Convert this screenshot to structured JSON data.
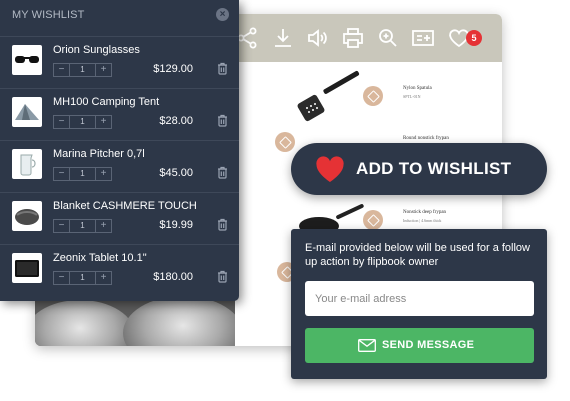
{
  "wishlist": {
    "title": "MY WISHLIST",
    "close_icon": "close-icon",
    "items": [
      {
        "name": "Orion Sunglasses",
        "qty": "1",
        "price": "$129.00",
        "minus": "−",
        "plus": "+"
      },
      {
        "name": "MH100 Camping Tent",
        "qty": "1",
        "price": "$28.00",
        "minus": "−",
        "plus": "+"
      },
      {
        "name": "Marina Pitcher 0,7l",
        "qty": "1",
        "price": "$45.00",
        "minus": "−",
        "plus": "+"
      },
      {
        "name": "Blanket CASHMERE TOUCH",
        "qty": "1",
        "price": "$19.99",
        "minus": "−",
        "plus": "+"
      },
      {
        "name": "Zeonix Tablet 10.1\"",
        "qty": "1",
        "price": "$180.00",
        "minus": "−",
        "plus": "+"
      }
    ]
  },
  "toolbar": {
    "icons": [
      "share-icon",
      "download-icon",
      "sound-icon",
      "print-icon",
      "zoom-icon",
      "add-note-icon",
      "heart-icon"
    ],
    "wishlist_count": "5"
  },
  "page": {
    "products": [
      {
        "title": "Nylon Spatula",
        "sub": "SPTL-01N"
      },
      {
        "title": "Round nonstick frypan",
        "sub": "28CM"
      },
      {
        "title": "Nonstick deep frypan",
        "sub": "Induction | 4.6mm thick"
      }
    ]
  },
  "add_to_wishlist": {
    "label": "ADD TO WISHLIST"
  },
  "email_form": {
    "text": "E-mail provided below will be used for a follow up action by flipbook owner",
    "placeholder": "Your e-mail adress",
    "button_label": "SEND MESSAGE"
  },
  "colors": {
    "panel": "#2d3748",
    "accent_red": "#e53235",
    "send_green": "#4cb665",
    "toolbar": "#c9c7bb"
  }
}
